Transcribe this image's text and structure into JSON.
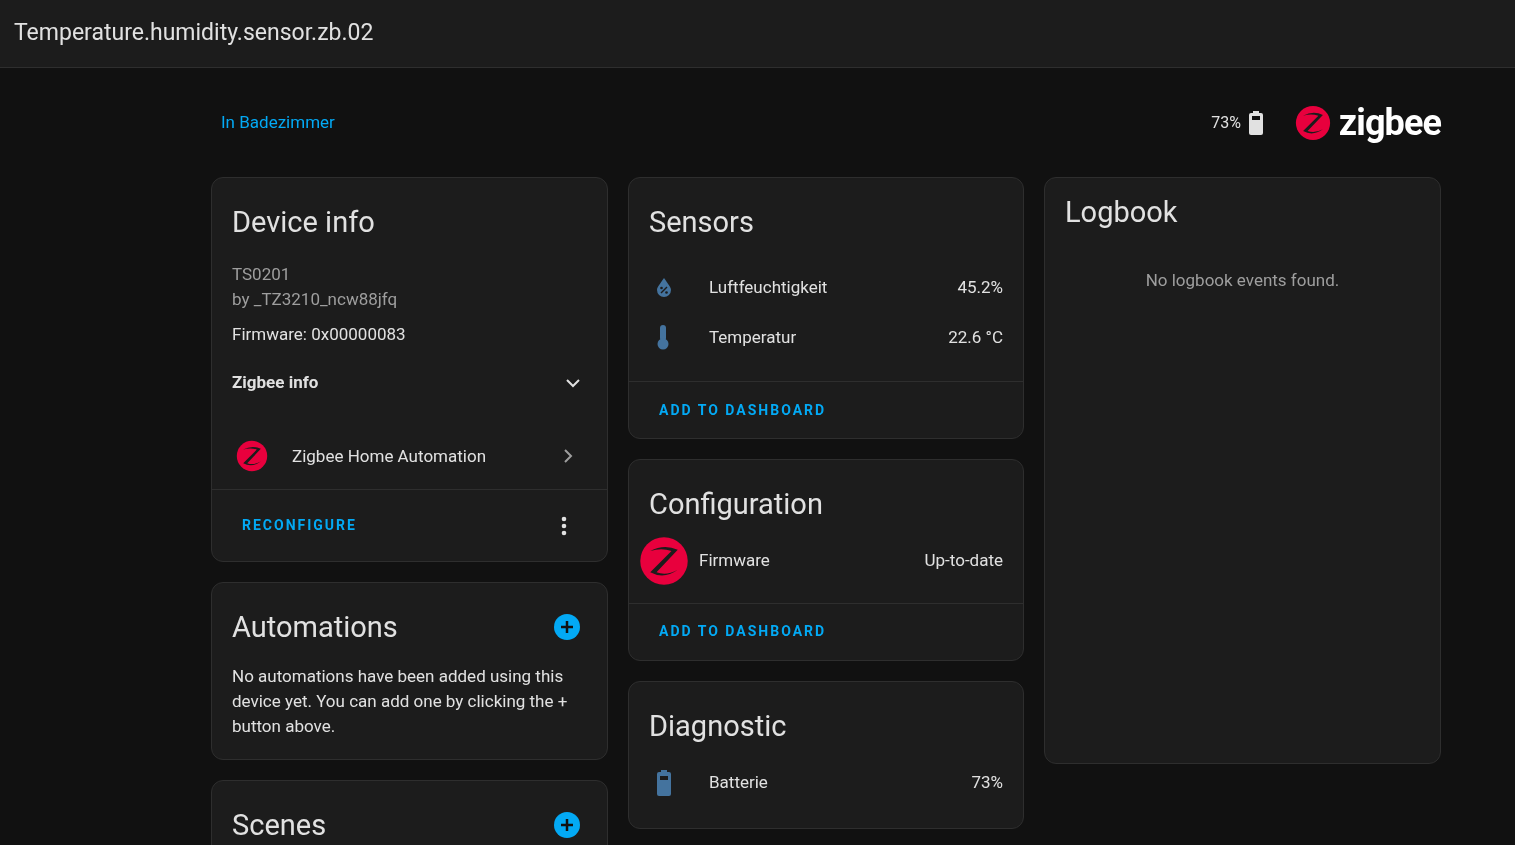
{
  "window": {
    "title": "Temperature.humidity.sensor.zb.02"
  },
  "area_link": "In Badezimmer",
  "header": {
    "battery": "73%",
    "logo_text": "zigbee"
  },
  "device_info": {
    "title": "Device info",
    "model": "TS0201",
    "manufacturer": "by _TZ3210_ncw88jfq",
    "firmware": "Firmware: 0x00000083",
    "zigbee_info": "Zigbee info",
    "integration": "Zigbee Home Automation",
    "action": "RECONFIGURE"
  },
  "automations": {
    "title": "Automations",
    "text": "No automations have been added using this device yet. You can add one by clicking the + button above."
  },
  "scenes": {
    "title": "Scenes"
  },
  "sensors": {
    "title": "Sensors",
    "rows": [
      {
        "kind": "humidity",
        "name": "Luftfeuchtigkeit",
        "value": "45.2%"
      },
      {
        "kind": "temperature",
        "name": "Temperatur",
        "value": "22.6 °C"
      }
    ],
    "action": "ADD TO DASHBOARD"
  },
  "configuration": {
    "title": "Configuration",
    "rows": [
      {
        "kind": "zigbee",
        "name": "Firmware",
        "value": "Up-to-date"
      }
    ],
    "action": "ADD TO DASHBOARD"
  },
  "diagnostic": {
    "title": "Diagnostic",
    "rows": [
      {
        "kind": "battery",
        "name": "Batterie",
        "value": "73%"
      }
    ]
  },
  "logbook": {
    "title": "Logbook",
    "empty": "No logbook events found."
  }
}
